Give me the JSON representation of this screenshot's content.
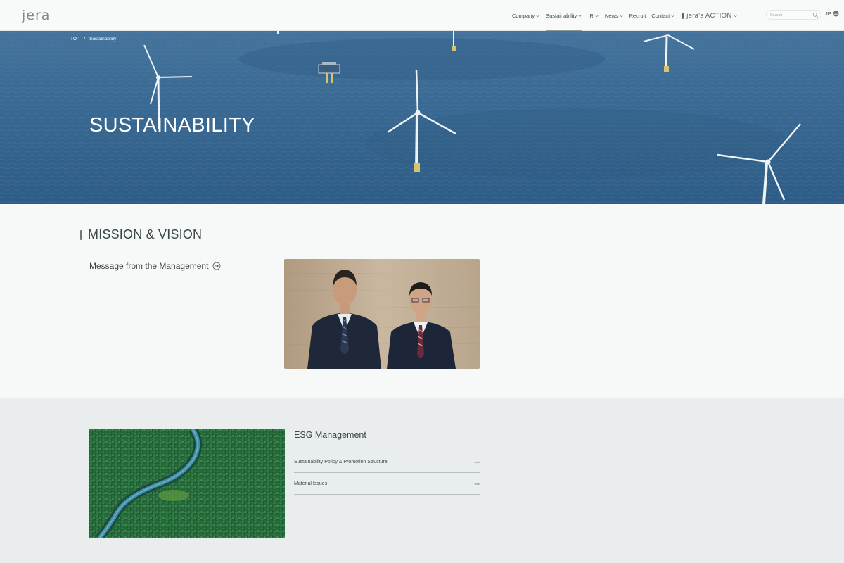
{
  "header": {
    "logo_text": "jera",
    "nav": [
      {
        "label": "Company"
      },
      {
        "label": "Sustainability"
      },
      {
        "label": "IR"
      },
      {
        "label": "News"
      },
      {
        "label": "Recruit"
      },
      {
        "label": "Contact"
      }
    ],
    "action_label": "jera's ACTION",
    "search_placeholder": "Search",
    "lang_label": "JP"
  },
  "hero": {
    "breadcrumb": [
      "TOP",
      "Sustainability"
    ],
    "title": "SUSTAINABILITY"
  },
  "mission": {
    "heading": "MISSION & VISION",
    "message_link": "Message from the Management"
  },
  "esg": {
    "title": "ESG Management",
    "items": [
      {
        "label": "Sustainability Policy & Promotion Structure"
      },
      {
        "label": "Material Issues"
      }
    ]
  },
  "colors": {
    "header_bg": "#f8f9f9",
    "sea": "#3a6a94",
    "esg_bg": "#e9eded",
    "text": "#3a4648"
  }
}
